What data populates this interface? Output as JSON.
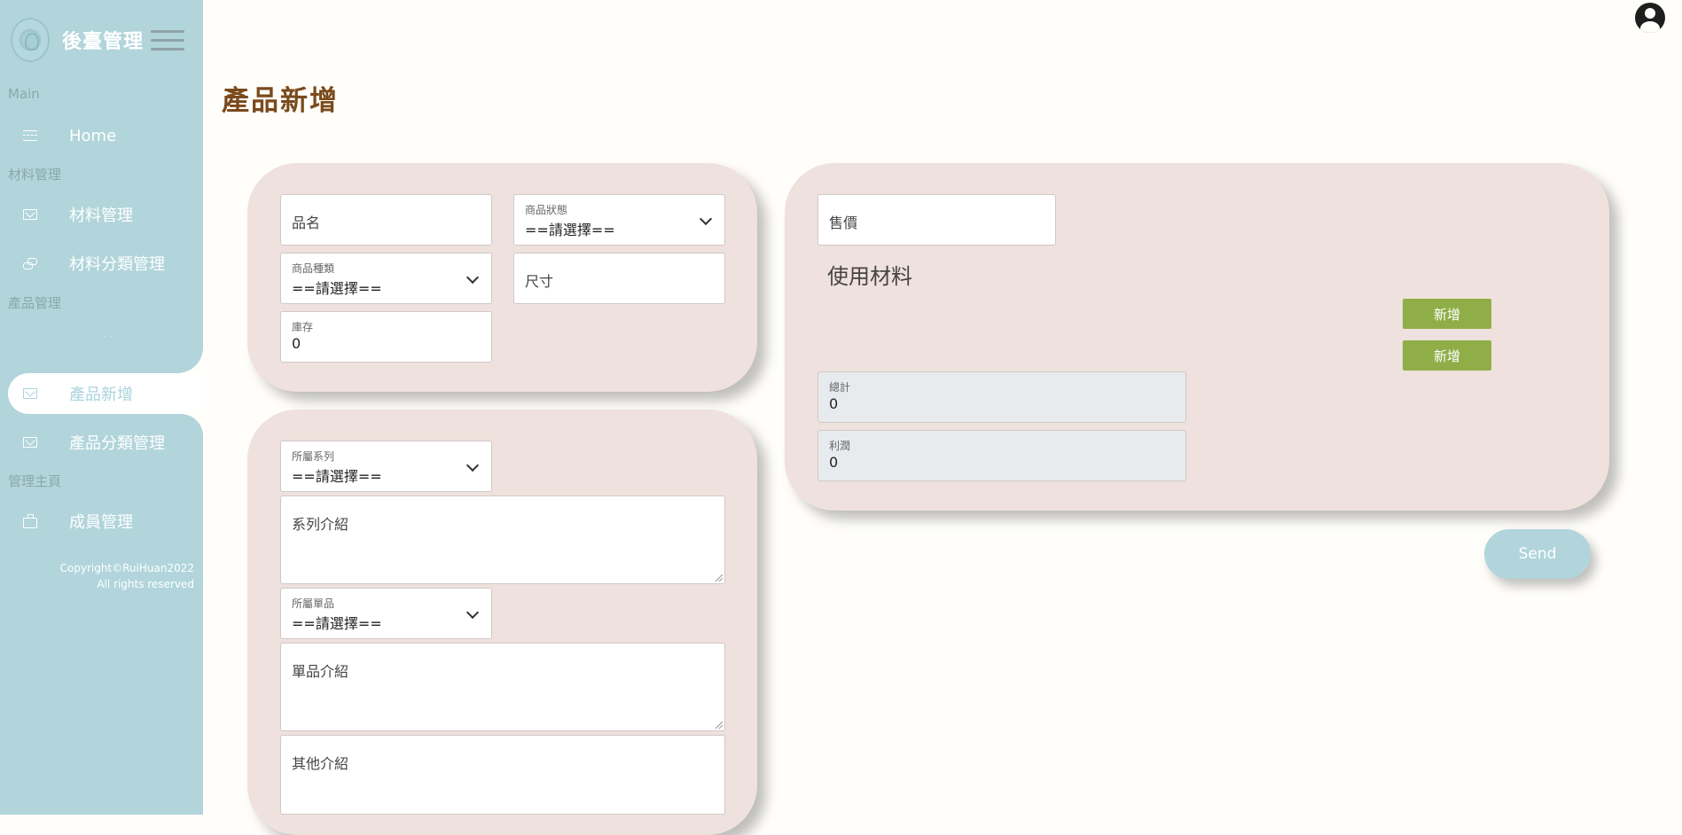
{
  "sidebar": {
    "brand": "後臺管理",
    "sections": {
      "main": "Main",
      "materials": "材料管理",
      "products": "產品管理",
      "admin": "管理主頁"
    },
    "items": [
      {
        "label": "Home",
        "icon": "home-icon"
      },
      {
        "label": "材料管理",
        "icon": "envelope-icon"
      },
      {
        "label": "材料分類管理",
        "icon": "link-icon"
      },
      {
        "label": "產品管理",
        "icon": "link-icon"
      },
      {
        "label": "產品新增",
        "icon": "envelope-icon",
        "active": true
      },
      {
        "label": "產品分類管理",
        "icon": "envelope-icon"
      },
      {
        "label": "成員管理",
        "icon": "briefcase-icon"
      }
    ],
    "copyright_line1": "Copyright©RuiHuan2022",
    "copyright_line2": "All rights reserved"
  },
  "page": {
    "title": "產品新增"
  },
  "basic_card": {
    "name_placeholder": "品名",
    "status_label": "商品狀態",
    "status_value": "==請選擇==",
    "type_label": "商品種類",
    "type_value": "==請選擇==",
    "size_placeholder": "尺寸",
    "stock_label": "庫存",
    "stock_value": "0"
  },
  "desc_card": {
    "series_label": "所屬系列",
    "series_value": "==請選擇==",
    "series_intro_placeholder": "系列介紹",
    "item_label": "所屬單品",
    "item_value": "==請選擇==",
    "item_intro_placeholder": "單品介紹",
    "other_intro_placeholder": "其他介紹"
  },
  "price_card": {
    "price_placeholder": "售價",
    "materials_heading": "使用材料",
    "add_button_1": "新增",
    "add_button_2": "新增",
    "total_label": "總計",
    "total_value": "0",
    "profit_label": "利潤",
    "profit_value": "0"
  },
  "actions": {
    "send": "Send"
  },
  "colors": {
    "sidebar_bg": "#b1d5db",
    "card_bg": "#efe1dd",
    "title_color": "#7a4a1d",
    "green_button": "#8fae48",
    "page_bg": "#fffefa"
  }
}
